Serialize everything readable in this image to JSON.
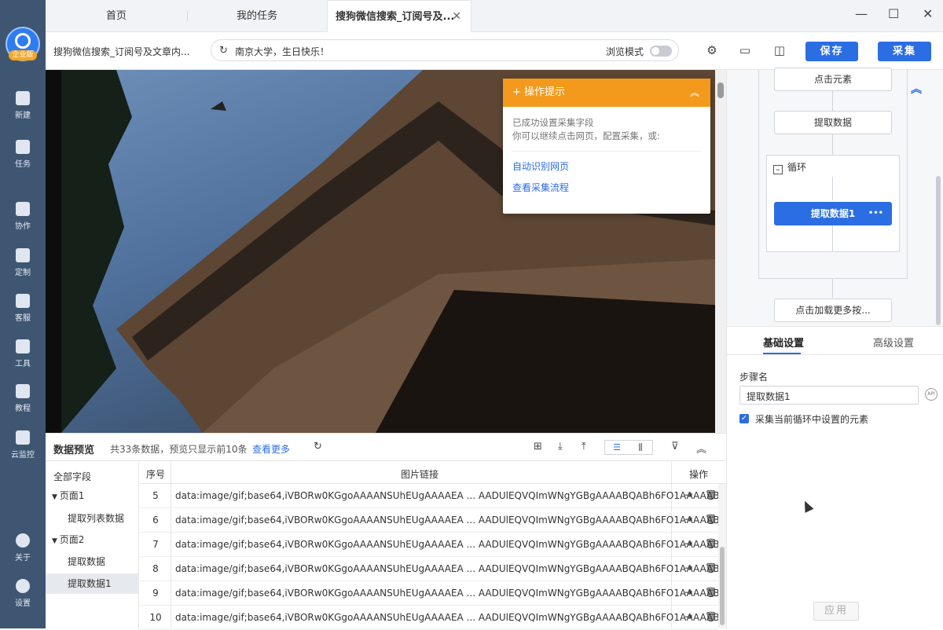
{
  "sidebar": {
    "logo_badge": "企业版",
    "items": [
      {
        "label": "新建",
        "icon": "plus-icon"
      },
      {
        "label": "任务",
        "icon": "bookmark-icon"
      },
      {
        "label": "协作",
        "icon": "people-icon"
      },
      {
        "label": "定制",
        "icon": "heart-icon"
      },
      {
        "label": "客服",
        "icon": "headset-icon"
      },
      {
        "label": "工具",
        "icon": "toolbox-icon"
      },
      {
        "label": "教程",
        "icon": "graduation-cap-icon"
      },
      {
        "label": "云监控",
        "icon": "cloud-monitor-icon"
      },
      {
        "label": "关于",
        "icon": "info-icon"
      },
      {
        "label": "设置",
        "icon": "gear-icon"
      }
    ]
  },
  "tabs": [
    {
      "label": "首页"
    },
    {
      "label": "我的任务"
    },
    {
      "label": "搜狗微信搜索_订阅号及..."
    }
  ],
  "window_controls": {
    "minimize": "—",
    "maximize": "☐",
    "close": "✕"
  },
  "toolbar": {
    "task_title": "搜狗微信搜索_订阅号及文章内...",
    "url": "南京大学，生日快乐！",
    "browse_mode_label": "浏览模式",
    "browse_mode_on": false,
    "save_label": "保存",
    "collect_label": "采集"
  },
  "hint_panel": {
    "title": "操作提示",
    "line1": "已成功设置采集字段",
    "line2": "你可以继续点击网页，配置采集，或:",
    "link1": "自动识别网页",
    "link2": "查看采集流程"
  },
  "data_preview": {
    "title": "数据预览",
    "info": "共33条数据，预览只显示前10条",
    "more_link": "查看更多"
  },
  "field_tree": {
    "all_fields": "全部字段",
    "items": [
      {
        "label": "页面1",
        "expanded": true
      },
      {
        "label": "提取列表数据"
      },
      {
        "label": "页面2",
        "expanded": true
      },
      {
        "label": "提取数据"
      },
      {
        "label": "提取数据1",
        "selected": true
      }
    ]
  },
  "grid": {
    "col_no": "序号",
    "col_link": "图片链接",
    "col_op": "操作",
    "rows": [
      {
        "no": "5",
        "link": "data:image/gif;base64,iVBORw0KGgoAAAANSUhEUgAAAAEA ... AADUlEQVQImWNgYGBgAAAABQABh6FO1AAAAAB..."
      },
      {
        "no": "6",
        "link": "data:image/gif;base64,iVBORw0KGgoAAAANSUhEUgAAAAEA ... AADUlEQVQImWNgYGBgAAAABQABh6FO1AAAAAB..."
      },
      {
        "no": "7",
        "link": "data:image/gif;base64,iVBORw0KGgoAAAANSUhEUgAAAAEA ... AADUlEQVQImWNgYGBgAAAABQABh6FO1AAAAAB..."
      },
      {
        "no": "8",
        "link": "data:image/gif;base64,iVBORw0KGgoAAAANSUhEUgAAAAEA ... AADUlEQVQImWNgYGBgAAAABQABh6FO1AAAAAB..."
      },
      {
        "no": "9",
        "link": "data:image/gif;base64,iVBORw0KGgoAAAANSUhEUgAAAAEA ... AADUlEQVQImWNgYGBgAAAABQABh6FO1AAAAAB..."
      },
      {
        "no": "10",
        "link": "data:image/gif;base64,iVBORw0KGgoAAAANSUhEUgAAAAEA ... AADUlEQVQImWNgYGBgAAAABQABh6FO1AAAAAB..."
      }
    ]
  },
  "flow": {
    "step_click": "点击元素",
    "step_extract": "提取数据",
    "loop_label": "循环",
    "step_extract1": "提取数据1",
    "step_more_options": "•••",
    "step_load_more": "点击加载更多按..."
  },
  "settings": {
    "tab_basic": "基础设置",
    "tab_advanced": "高级设置",
    "step_name_label": "步骤名",
    "step_name_value": "提取数据1",
    "api_icon_text": "API",
    "checkbox_label": "采集当前循环中设置的元素",
    "checkbox_checked": true,
    "apply_label": "应用"
  }
}
